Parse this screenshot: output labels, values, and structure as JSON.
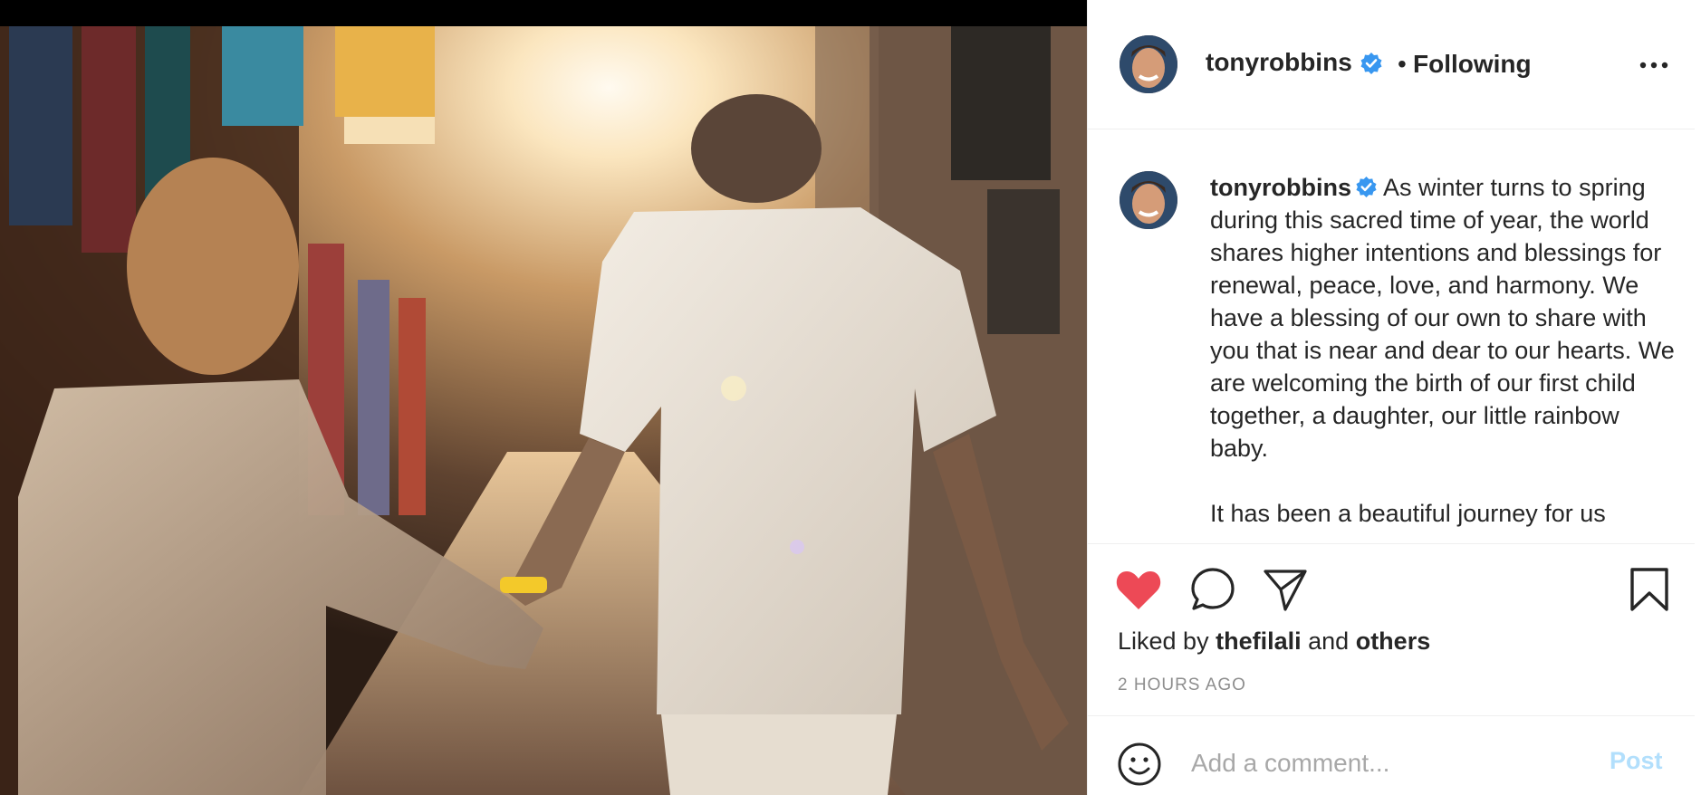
{
  "post": {
    "image_alt": "Couple holding hands walking down a sunlit market alley",
    "username": "tonyrobbins",
    "separator": "•",
    "follow_status": "Following",
    "more_icon": "more-horizontal-icon",
    "caption_paragraphs": [
      "As winter turns to spring during this sacred time of year, the world shares higher intentions and blessings for renewal, peace, love, and harmony. We have a blessing of our own to share with you that is near and dear to our hearts. We are welcoming the birth of our first child together, a daughter, our little rainbow baby.",
      "It has been a beautiful journey for us"
    ],
    "liked_by_prefix": "Liked by",
    "liked_by_user": "thefilali",
    "liked_by_and": "and",
    "liked_by_others": "others",
    "timestamp": "2 HOURS AGO",
    "comment_placeholder": "Add a comment...",
    "post_button": "Post"
  },
  "colors": {
    "like_red": "#ed4956",
    "verified_blue": "#3897f0",
    "post_disabled": "#b2dffc",
    "muted": "#8e8e8e"
  }
}
